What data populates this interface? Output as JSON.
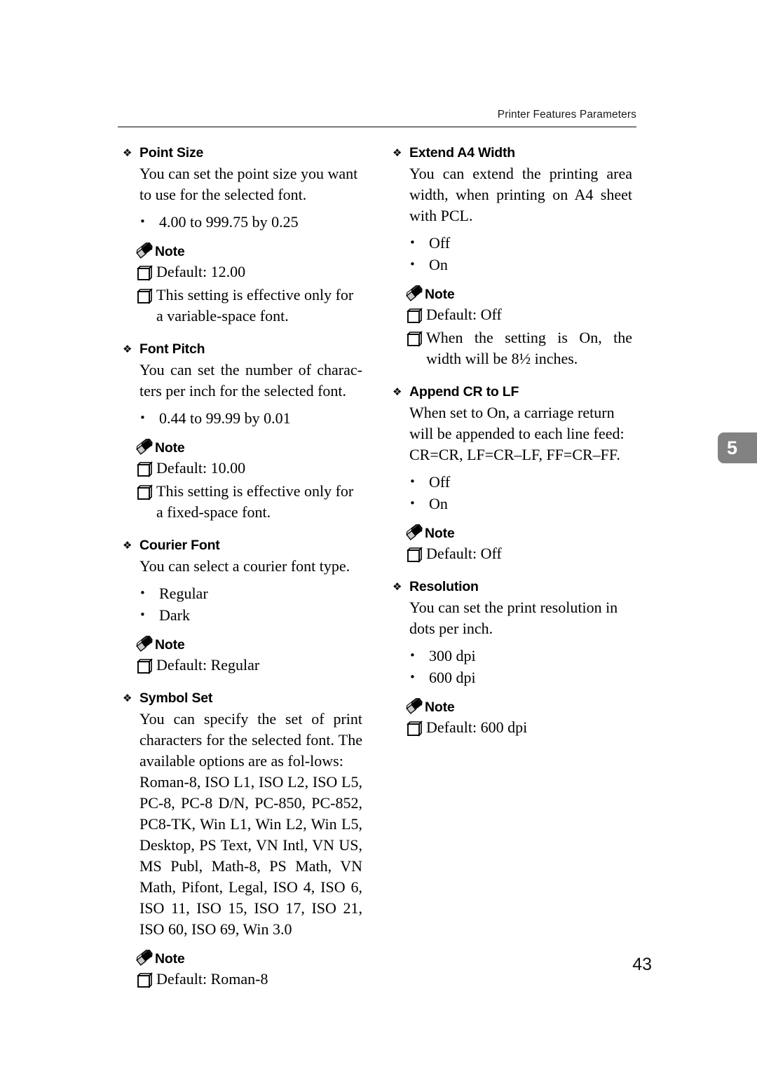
{
  "page": {
    "header_title": "Printer Features Parameters",
    "chapter_tab": "5",
    "page_number": "43",
    "tab_color": "#828282",
    "rule_color": "#7a7a7a"
  },
  "icons": {
    "section_marker": "❖",
    "bullet_marker": "•",
    "note_label": "Note",
    "note_icon_name": "pencil-icon",
    "checkbox_icon_name": "note-square-icon"
  },
  "left_column": {
    "sections": [
      {
        "title": "Point Size",
        "body": "You can set the point size you want to use for the selected font.",
        "options": [
          "4.00 to 999.75 by 0.25"
        ],
        "note_label": "Note",
        "notes": [
          "Default: 12.00",
          "This setting is effective only for a variable-space font."
        ]
      },
      {
        "title": "Font Pitch",
        "body": "You can set the number of charac-ters per inch for the selected font.",
        "options": [
          "0.44 to 99.99 by 0.01"
        ],
        "note_label": "Note",
        "notes": [
          "Default: 10.00",
          "This setting is effective only for a fixed-space font."
        ]
      },
      {
        "title": "Courier Font",
        "body": "You can select a courier font type.",
        "options": [
          "Regular",
          "Dark"
        ],
        "note_label": "Note",
        "notes": [
          "Default: Regular"
        ]
      },
      {
        "title": "Symbol Set",
        "body": "You can specify the set of print characters for the selected font. The available options are as fol-lows:",
        "body2": "Roman-8, ISO L1, ISO L2, ISO L5, PC-8, PC-8 D/N, PC-850, PC-852, PC8-TK, Win L1, Win L2, Win L5, Desktop, PS Text, VN Intl, VN US, MS Publ, Math-8, PS Math, VN Math, Pifont, Legal, ISO 4, ISO 6, ISO 11, ISO 15, ISO 17, ISO 21, ISO 60, ISO 69, Win 3.0",
        "options": [],
        "note_label": "Note",
        "notes": [
          "Default: Roman-8"
        ]
      }
    ]
  },
  "right_column": {
    "sections": [
      {
        "title": "Extend A4 Width",
        "body": "You can extend the printing area width, when printing on A4 sheet with PCL.",
        "options": [
          "Off",
          "On"
        ],
        "note_label": "Note",
        "notes": [
          "Default: Off",
          "When the setting is On, the width will be 8½ inches."
        ]
      },
      {
        "title": "Append CR to LF",
        "body": "When set to On, a carriage return will be appended to each line feed: CR=CR, LF=CR–LF, FF=CR–FF.",
        "options": [
          "Off",
          "On"
        ],
        "note_label": "Note",
        "notes": [
          "Default: Off"
        ]
      },
      {
        "title": "Resolution",
        "body": "You can set the print resolution in dots per inch.",
        "options": [
          "300 dpi",
          "600 dpi"
        ],
        "note_label": "Note",
        "notes": [
          "Default: 600 dpi"
        ]
      }
    ]
  }
}
